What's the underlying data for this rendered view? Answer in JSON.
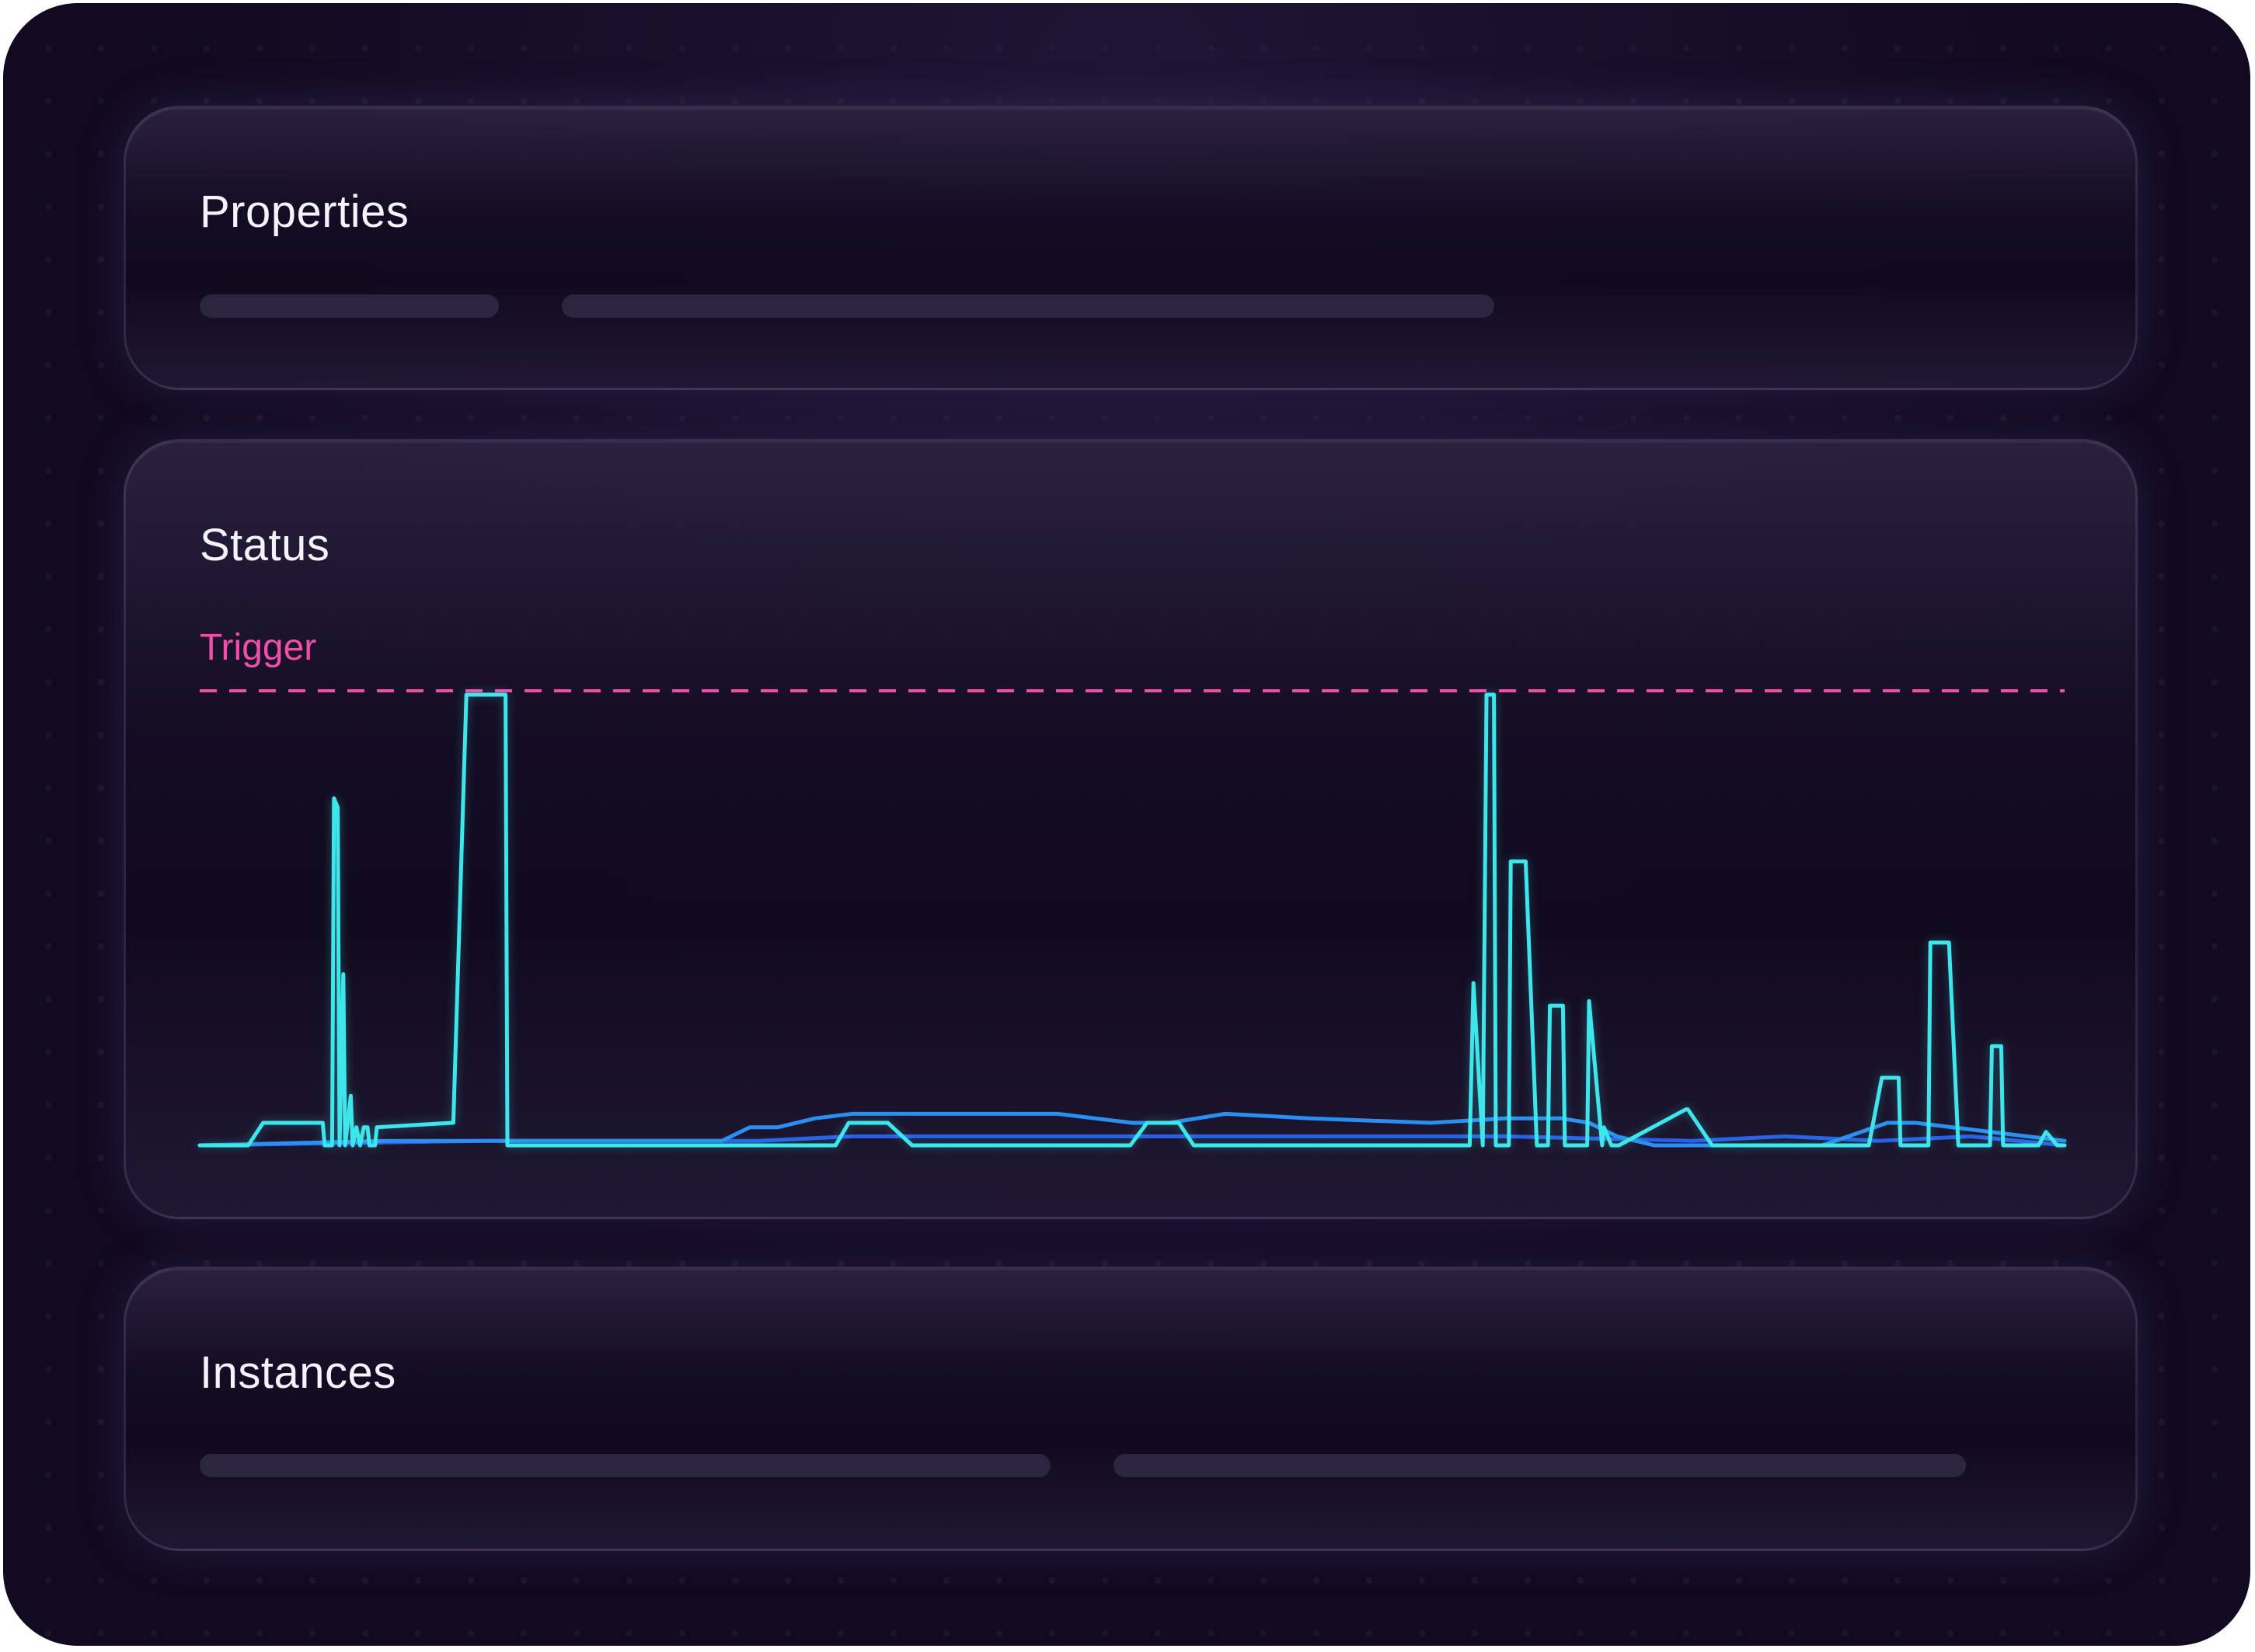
{
  "properties": {
    "title": "Properties"
  },
  "status": {
    "title": "Status",
    "trigger_label": "Trigger"
  },
  "instances": {
    "title": "Instances"
  },
  "colors": {
    "background": "#110a20",
    "trigger_line": "#ef4fa8",
    "series_primary": "#3ee6ec",
    "series_secondary": "#2a8ff0",
    "series_tertiary": "#2760e6",
    "placeholder": "#2c2540"
  },
  "chart_data": {
    "type": "line",
    "title": "",
    "xlabel": "",
    "ylabel": "",
    "xlim": [
      0,
      100
    ],
    "ylim": [
      0,
      100
    ],
    "grid": false,
    "legend": "none",
    "threshold": {
      "label": "Trigger",
      "value": 100,
      "style": "dashed"
    },
    "series": [
      {
        "color": "#3ee6ec",
        "x": [
          0,
          2.6,
          3.4,
          6.6,
          6.7,
          7.1,
          7.2,
          7.4,
          7.5,
          7.7,
          7.8,
          8.1,
          8.2,
          8.4,
          8.6,
          8.8,
          9.0,
          9.1,
          9.4,
          9.5,
          13.5,
          13.6,
          14.3,
          14.4,
          16.4,
          16.5,
          34.1,
          34.8,
          36.9,
          38.2,
          49.9,
          50.8,
          52.5,
          53.3,
          68.1,
          68.3,
          68.8,
          69.0,
          69.4,
          69.5,
          70.2,
          70.3,
          71.1,
          71.7,
          72.3,
          72.4,
          73.1,
          73.2,
          74.4,
          74.5,
          75.2,
          75.3,
          75.7,
          76.0,
          76.1,
          79.7,
          79.8,
          81.1,
          81.2,
          89.5,
          90.2,
          91.1,
          91.2,
          92.7,
          92.8,
          93.8,
          94.3,
          96.0,
          96.1,
          96.6,
          96.7,
          98.2,
          98.6,
          99.0,
          99.6,
          100
        ],
        "y": [
          0,
          0,
          5,
          5,
          0,
          0,
          77,
          75,
          0,
          38,
          0,
          11,
          0,
          4,
          0,
          4,
          4,
          0,
          0,
          4,
          5,
          5,
          100,
          100,
          100,
          0,
          0,
          5,
          5,
          0,
          0,
          5,
          5,
          0,
          0,
          36,
          0,
          100,
          100,
          0,
          0,
          63,
          63,
          0,
          0,
          31,
          31,
          0,
          0,
          32,
          0,
          4,
          0,
          0,
          0,
          8,
          8,
          0,
          0,
          0,
          15,
          15,
          0,
          0,
          45,
          45,
          0,
          0,
          22,
          22,
          0,
          0,
          0,
          3,
          0,
          0
        ]
      },
      {
        "color": "#2a8ff0",
        "x": [
          0,
          10,
          20,
          28,
          29.5,
          31,
          33,
          35,
          39,
          40,
          43,
          46,
          50,
          52,
          53.5,
          55,
          59.5,
          66,
          70,
          73,
          74.5,
          76,
          78,
          82,
          87,
          90.5,
          92,
          96,
          100
        ],
        "y": [
          0,
          1,
          1,
          1,
          4,
          4,
          6,
          7,
          7,
          7,
          7,
          7,
          5,
          5,
          6,
          7,
          6,
          5,
          6,
          6,
          5,
          2,
          0,
          0,
          0,
          5,
          5,
          3,
          1
        ]
      },
      {
        "color": "#2760e6",
        "x": [
          0,
          15,
          30,
          35,
          40,
          50,
          60,
          70,
          80,
          85,
          90,
          95,
          100
        ],
        "y": [
          0,
          1,
          1,
          2,
          2,
          2,
          2,
          2,
          1,
          2,
          1,
          2,
          0
        ]
      }
    ]
  }
}
